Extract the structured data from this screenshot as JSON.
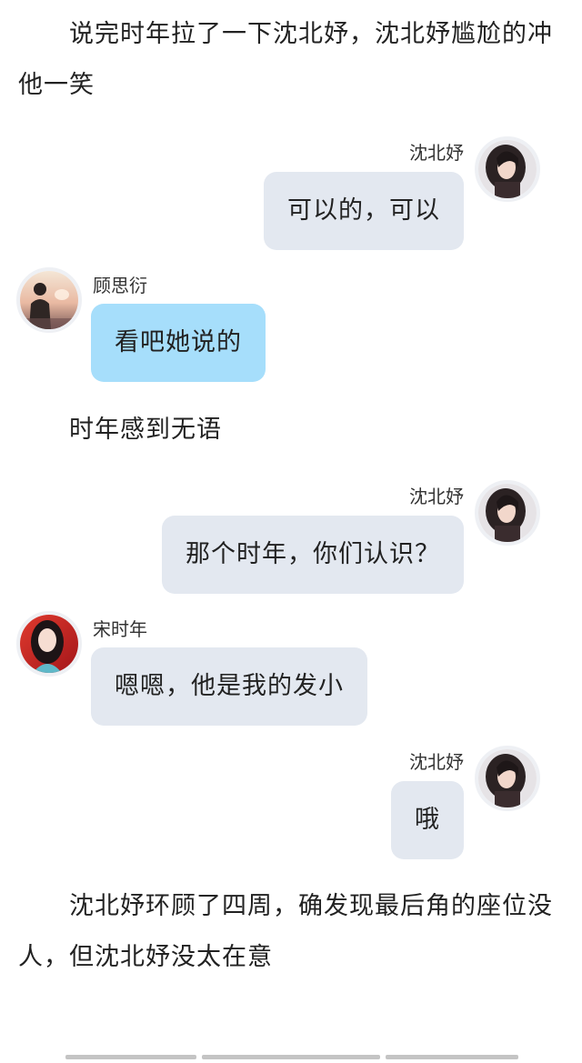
{
  "narration": [
    "说完时年拉了一下沈北妤，沈北妤尴尬的冲他一笑",
    "时年感到无语",
    "沈北妤环顾了四周，确发现最后角的座位没人，但沈北妤没太在意"
  ],
  "messages": [
    {
      "sender": "沈北妤",
      "text": "可以的，可以",
      "side": "right",
      "avatar": "dark-hair-girl-avatar"
    },
    {
      "sender": "顾思衍",
      "text": "看吧她说的",
      "side": "left",
      "avatar": "silhouette-sunset-avatar"
    },
    {
      "sender": "沈北妤",
      "text": "那个时年，你们认识？",
      "side": "right",
      "avatar": "dark-hair-girl-avatar"
    },
    {
      "sender": "宋时年",
      "text": "嗯嗯，他是我的发小",
      "side": "left",
      "avatar": "red-background-girl-avatar"
    },
    {
      "sender": "沈北妤",
      "text": "哦",
      "side": "right",
      "avatar": "dark-hair-girl-avatar"
    }
  ],
  "colors": {
    "bubble_grey": "#e3e8f0",
    "bubble_blue": "#a6defb",
    "text": "#222222"
  }
}
